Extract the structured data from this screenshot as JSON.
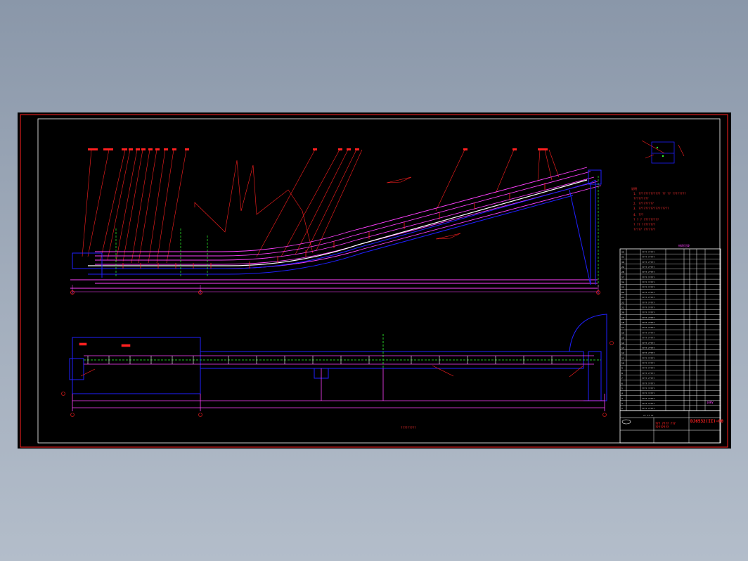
{
  "drawing": {
    "revisions_header": "修改记录",
    "notes": {
      "title": "说明",
      "lines": [
        "1. ????????????? ?? ?? ????????",
        "   ?????????",
        "2. ?????????",
        "3. ??????????????????",
        "4. ???",
        "   ? ? ?    ?????????",
        "   ? ?? ????????",
        "   ????? ???????"
      ]
    },
    "parts_rows": [
      "???? ?????",
      "???? ?????",
      "???? ?????",
      "???? ?????",
      "???? ?????",
      "???? ?????",
      "???? ?????",
      "???? ?????",
      "???? ?????",
      "???? ?????",
      "???? ?????",
      "???? ?????",
      "???? ?????",
      "???? ?????",
      "???? ?????",
      "???? ?????",
      "???? ?????",
      "???? ?????",
      "???? ?????",
      "???? ?????",
      "???? ?????",
      "???? ?????",
      "???? ?????",
      "???? ?????",
      "???? ?????",
      "???? ?????",
      "???? ?????",
      "???? ?????",
      "???? ?????",
      "???? ?????",
      "???? ?????",
      "???? ?????"
    ],
    "voltage": "10KV",
    "title_block": {
      "header": "?? ?? ??",
      "drawing_no": "DJ6532(II)-00",
      "name_line1": "??? ???? ???",
      "name_line2": "????????"
    },
    "dimension_bottom": "?????????"
  }
}
